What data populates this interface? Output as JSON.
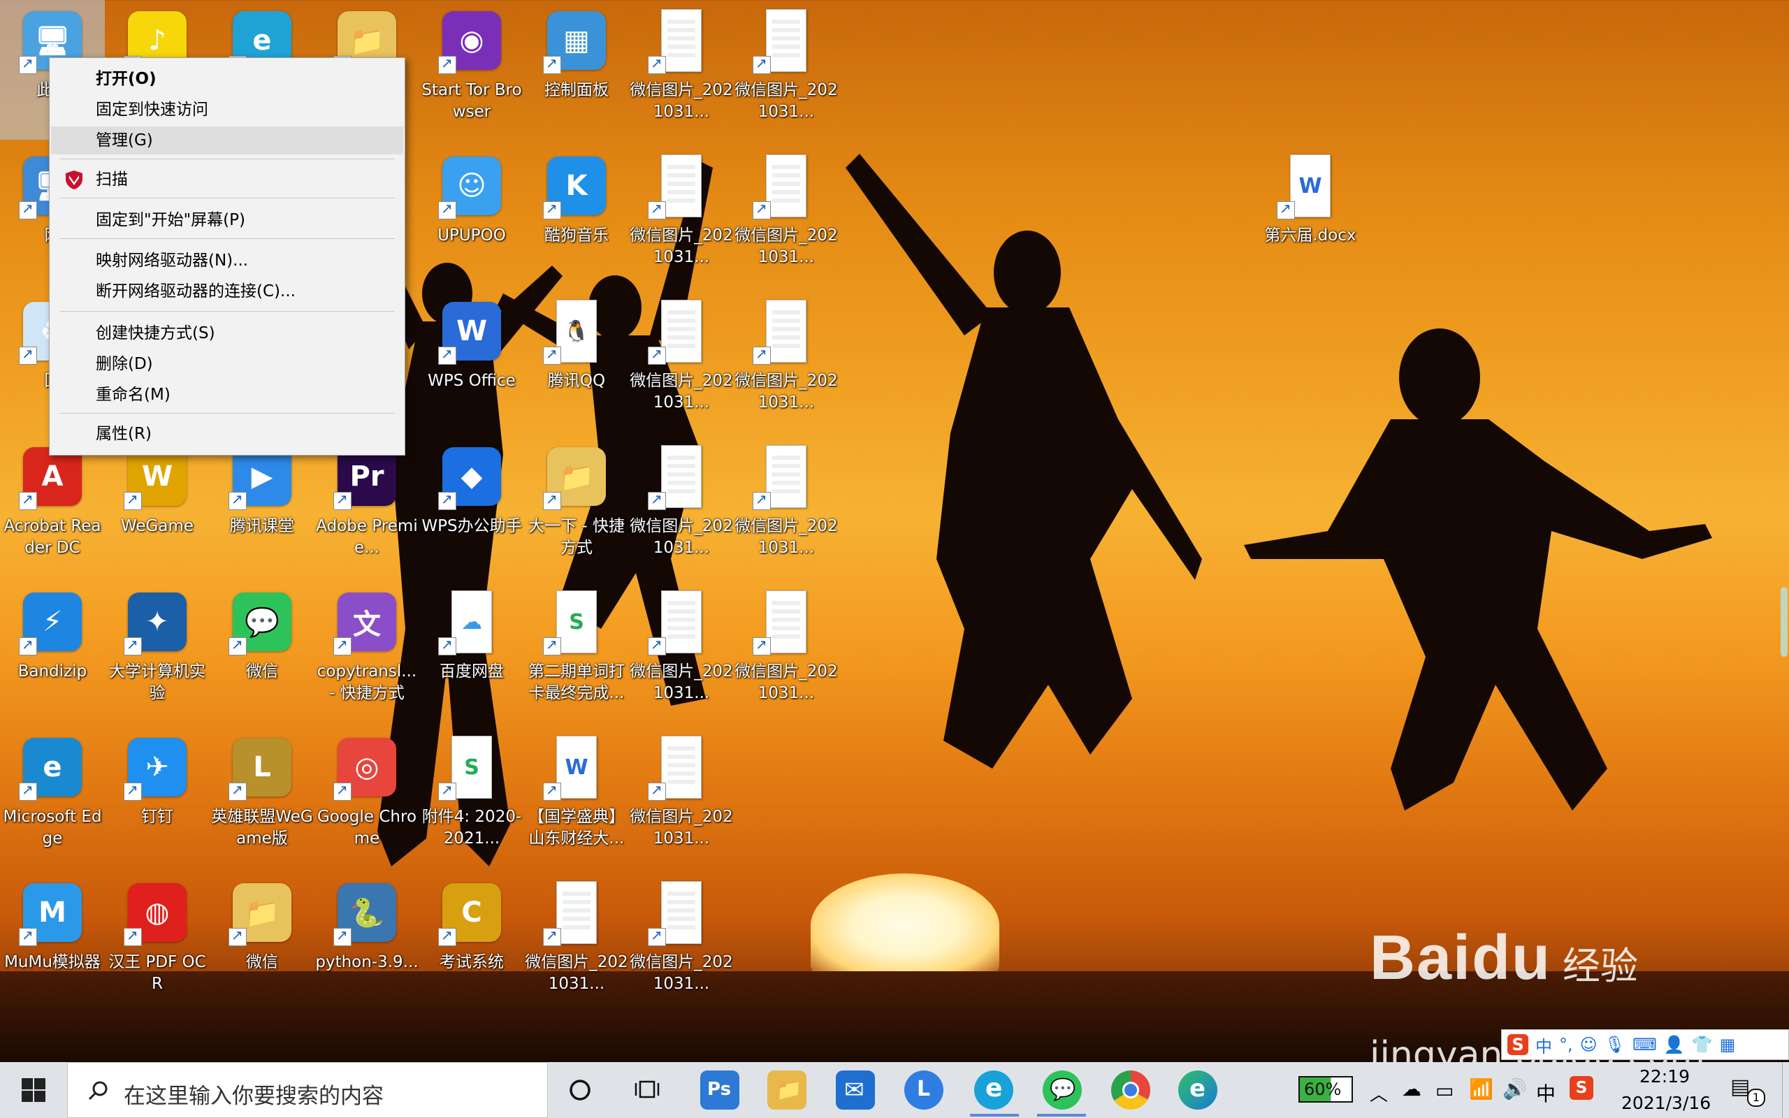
{
  "desktop": {
    "icons": [
      {
        "id": "this-pc",
        "label": "此电",
        "color": "#4aa3e0",
        "glyph": "🖥"
      },
      {
        "id": "qqmusic",
        "label": "",
        "color": "#f7d70a",
        "glyph": "♪"
      },
      {
        "id": "ie",
        "label": "",
        "color": "#1fa3d6",
        "glyph": "e"
      },
      {
        "id": "folder1",
        "label": "",
        "color": "#e8c25c",
        "glyph": "📁"
      },
      {
        "id": "tor",
        "label": "Start Tor Browser",
        "color": "#7b2fb8",
        "glyph": "◉"
      },
      {
        "id": "control",
        "label": "控制面板",
        "color": "#3a93d8",
        "glyph": "▦"
      },
      {
        "id": "wx1",
        "label": "微信图片_2021031...",
        "color": "#ffffff",
        "glyph": ""
      },
      {
        "id": "wx2",
        "label": "微信图片_2021031...",
        "color": "#ffffff",
        "glyph": ""
      },
      {
        "id": "network",
        "label": "网",
        "color": "#3f8ad6",
        "glyph": "🖥"
      },
      {
        "id": "upupoo",
        "label": "UPUPOO",
        "color": "#3aa0f0",
        "glyph": "☺"
      },
      {
        "id": "kugou",
        "label": "酷狗音乐",
        "color": "#1e90e8",
        "glyph": "K"
      },
      {
        "id": "wx3",
        "label": "微信图片_2021031...",
        "color": "#ffffff",
        "glyph": ""
      },
      {
        "id": "wx4",
        "label": "微信图片_2021031...",
        "color": "#ffffff",
        "glyph": ""
      },
      {
        "id": "docx",
        "label": "第六届.docx",
        "color": "#ffffff",
        "glyph": "W"
      },
      {
        "id": "recycle",
        "label": "回",
        "color": "#cfe6f7",
        "glyph": "♻"
      },
      {
        "id": "wps",
        "label": "WPS Office",
        "color": "#2a6bd8",
        "glyph": "W"
      },
      {
        "id": "qq",
        "label": "腾讯QQ",
        "color": "#ffffff",
        "glyph": "🐧"
      },
      {
        "id": "wx5",
        "label": "微信图片_2021031...",
        "color": "#ffffff",
        "glyph": ""
      },
      {
        "id": "wx6",
        "label": "微信图片_2021031...",
        "color": "#ffffff",
        "glyph": ""
      },
      {
        "id": "acrobat",
        "label": "Acrobat Reader DC",
        "color": "#d9261c",
        "glyph": "A"
      },
      {
        "id": "wegame",
        "label": "WeGame",
        "color": "#e0a400",
        "glyph": "W"
      },
      {
        "id": "tencent-class",
        "label": "腾讯课堂",
        "color": "#2d8ae8",
        "glyph": "▶"
      },
      {
        "id": "premiere",
        "label": "Adobe Premie...",
        "color": "#2a0a4a",
        "glyph": "Pr"
      },
      {
        "id": "wps-helper",
        "label": "WPS办公助手",
        "color": "#1c6fe0",
        "glyph": "◆"
      },
      {
        "id": "shortcut-dayi",
        "label": "大一下 - 快捷方式",
        "color": "#e8c25c",
        "glyph": "📁"
      },
      {
        "id": "wx7",
        "label": "微信图片_2021031...",
        "color": "#ffffff",
        "glyph": ""
      },
      {
        "id": "wx8",
        "label": "微信图片_2021031...",
        "color": "#ffffff",
        "glyph": ""
      },
      {
        "id": "bandizip",
        "label": "Bandizip",
        "color": "#1e86e0",
        "glyph": "⚡"
      },
      {
        "id": "computer-lab",
        "label": "大学计算机实验",
        "color": "#1a5fa8",
        "glyph": "✦"
      },
      {
        "id": "wechat",
        "label": "微信",
        "color": "#2ec25b",
        "glyph": "💬"
      },
      {
        "id": "copytrans",
        "label": "copytransl... - 快捷方式",
        "color": "#8a4fc8",
        "glyph": "文"
      },
      {
        "id": "baidu-pan",
        "label": "百度网盘",
        "color": "#ffffff",
        "glyph": "☁"
      },
      {
        "id": "xls2",
        "label": "第二期单词打卡最终完成...",
        "color": "#ffffff",
        "glyph": "S"
      },
      {
        "id": "wx9",
        "label": "微信图片_2021031...",
        "color": "#ffffff",
        "glyph": ""
      },
      {
        "id": "wx10",
        "label": "微信图片_2021031...",
        "color": "#ffffff",
        "glyph": ""
      },
      {
        "id": "edge",
        "label": "Microsoft Edge",
        "color": "#1a8ad0",
        "glyph": "e"
      },
      {
        "id": "dingtalk",
        "label": "钉钉",
        "color": "#1f8ff0",
        "glyph": "✈"
      },
      {
        "id": "lol",
        "label": "英雄联盟WeGame版",
        "color": "#b8902c",
        "glyph": "L"
      },
      {
        "id": "chrome",
        "label": "Google Chrome",
        "color": "#e8453c",
        "glyph": "◎"
      },
      {
        "id": "attach4",
        "label": "附件4: 2020-2021...",
        "color": "#ffffff",
        "glyph": "S"
      },
      {
        "id": "guoxue",
        "label": "【国学盛典】山东财经大...",
        "color": "#ffffff",
        "glyph": "W"
      },
      {
        "id": "wx11",
        "label": "微信图片_2021031...",
        "color": "#ffffff",
        "glyph": ""
      },
      {
        "id": "mumu",
        "label": "MuMu模拟器",
        "color": "#2a9ae8",
        "glyph": "M"
      },
      {
        "id": "hanwang",
        "label": "汉王 PDF OCR",
        "color": "#e0201c",
        "glyph": "◍"
      },
      {
        "id": "wechat-folder",
        "label": "微信",
        "color": "#e8c25c",
        "glyph": "📁"
      },
      {
        "id": "python",
        "label": "python-3.9...",
        "color": "#3a76b0",
        "glyph": "🐍"
      },
      {
        "id": "exam",
        "label": "考试系统",
        "color": "#d8a010",
        "glyph": "C"
      },
      {
        "id": "wx12",
        "label": "微信图片_2021031...",
        "color": "#ffffff",
        "glyph": ""
      },
      {
        "id": "wx13",
        "label": "微信图片_2021031...",
        "color": "#ffffff",
        "glyph": ""
      }
    ]
  },
  "context_menu": {
    "items": {
      "open": "打开(O)",
      "pin_quick": "固定到快速访问",
      "manage": "管理(G)",
      "scan": "扫描",
      "pin_start": "固定到\"开始\"屏幕(P)",
      "map_drive": "映射网络驱动器(N)...",
      "disconnect_drive": "断开网络驱动器的连接(C)...",
      "create_shortcut": "创建快捷方式(S)",
      "delete": "删除(D)",
      "rename": "重命名(M)",
      "properties": "属性(R)"
    }
  },
  "taskbar": {
    "search_placeholder": "在这里输入你要搜索的内容",
    "battery": "60%",
    "ime_lang": "中",
    "time": "22:19",
    "date": "2021/3/16",
    "notification_count": "1"
  },
  "watermark": {
    "brand": "Bai",
    "brand2": "du",
    "jingyan": "经验",
    "url": "jingyan.baidu.com"
  },
  "ime_bar": {
    "lang": "中"
  },
  "colors": {
    "menu_bg": "#f2f2f2",
    "menu_hover": "#dedede",
    "taskbar_bg": "#dfe3e8",
    "mcafee_red": "#c8102e"
  }
}
